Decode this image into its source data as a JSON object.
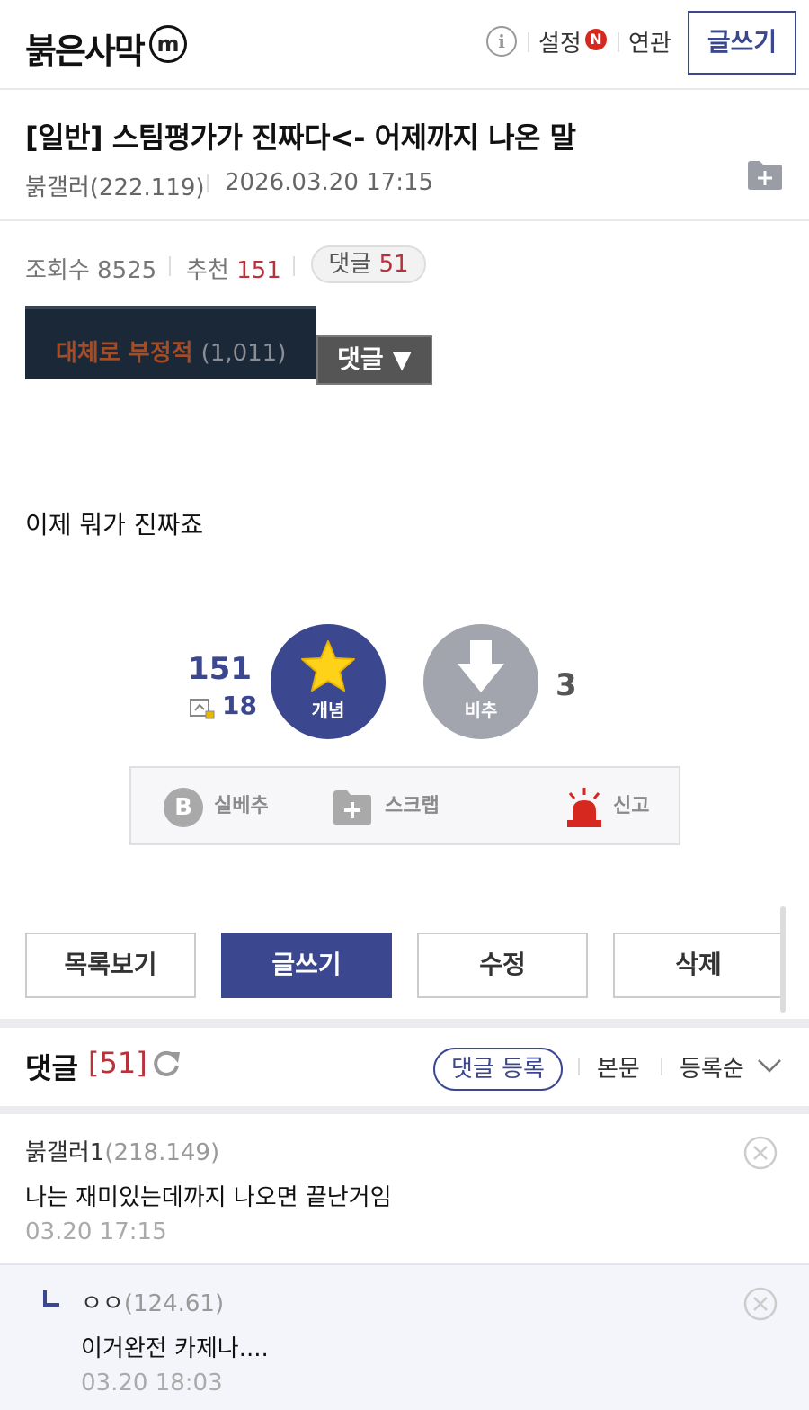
{
  "header": {
    "logo": "붉은사막",
    "logo_mark": "m",
    "info_icon": "info-icon",
    "settings_label": "설정",
    "new_badge": "N",
    "related_label": "연관",
    "write_label": "글쓰기"
  },
  "post": {
    "title": "[일반] 스팀평가가 진짜다<- 어제까지 나온 말",
    "author": "붉갤러(222.119)",
    "date": "2026.03.20 17:15",
    "stats": {
      "views_label": "조회수",
      "views": "8525",
      "recommend_label": "추천",
      "recommend": "151",
      "comments_label": "댓글",
      "comments": "51"
    },
    "steam": {
      "rating": "대체로 부정적",
      "count": "(1,011)",
      "button": "댓글 ▼"
    },
    "body": "이제 뭐가 진짜죠"
  },
  "vote": {
    "up_count": "151",
    "fix_count": "18",
    "up_label": "개념",
    "down_label": "비추",
    "down_count": "3"
  },
  "actions": {
    "best": "실베추",
    "best_icon_letter": "B",
    "scrap": "스크랩",
    "report": "신고"
  },
  "buttons": {
    "list": "목록보기",
    "write": "글쓰기",
    "edit": "수정",
    "delete": "삭제"
  },
  "comments_header": {
    "title": "댓글",
    "count": "[51]",
    "register": "댓글 등록",
    "body_link": "본문",
    "sort": "등록순"
  },
  "comments": [
    {
      "author": "붉갤러1",
      "ip": "(218.149)",
      "text": "나는 재미있는데까지 나오면 끝난거임",
      "date": "03.20 17:15"
    },
    {
      "author": "ㅇㅇ",
      "ip": "(124.61)",
      "text": "이거완전 카제나....",
      "date": "03.20 18:03"
    }
  ],
  "colors": {
    "accent": "#3b4890",
    "red": "#b7323a",
    "steam_bg": "#1b2838",
    "steam_negative": "#a34c25"
  }
}
